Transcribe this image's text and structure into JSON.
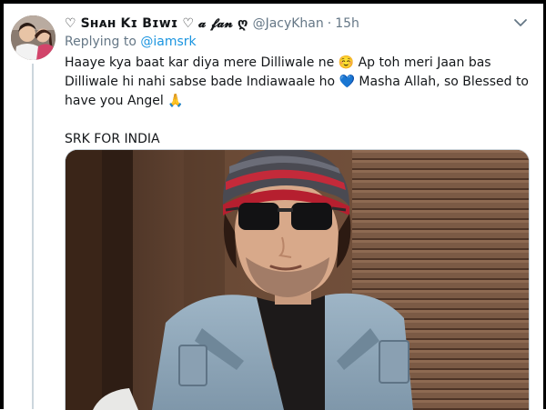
{
  "tweet": {
    "display_name": "♡ Sʜᴀʜ Kɪ Bɪᴡɪ ♡ 𝓪 𝓯𝓪𝓷 ღ",
    "username": "@JacyKhan",
    "separator": "·",
    "time": "15h",
    "replying_to_label": "Replying to",
    "replying_to_handle": "@iamsrk",
    "body": "Haaye kya baat kar diya mere Dilliwale ne ☺️ Ap toh meri Jaan bas Dilliwale hi nahi sabse bade Indiawaale ho 💙 Masha Allah, so Blessed to have you Angel 🙏",
    "body_tag": "SRK FOR INDIA"
  },
  "icons": {
    "more": "chevron-down-icon",
    "avatar": "profile-avatar"
  },
  "colors": {
    "link": "#1b95e0",
    "secondary_text": "#657786",
    "primary_text": "#14171a",
    "border": "#ccd6dd"
  }
}
